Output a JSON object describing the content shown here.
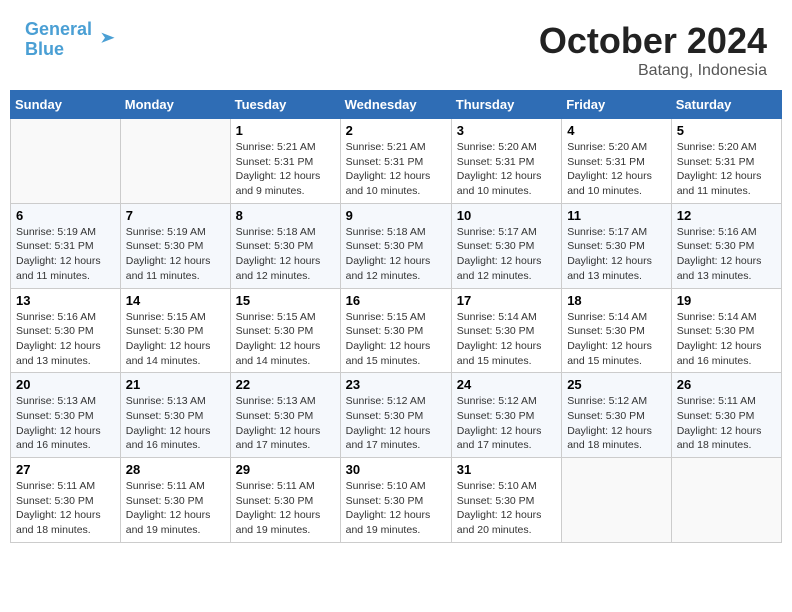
{
  "header": {
    "logo_line1": "General",
    "logo_line2": "Blue",
    "month": "October 2024",
    "location": "Batang, Indonesia"
  },
  "weekdays": [
    "Sunday",
    "Monday",
    "Tuesday",
    "Wednesday",
    "Thursday",
    "Friday",
    "Saturday"
  ],
  "weeks": [
    [
      {
        "day": "",
        "info": ""
      },
      {
        "day": "",
        "info": ""
      },
      {
        "day": "1",
        "info": "Sunrise: 5:21 AM\nSunset: 5:31 PM\nDaylight: 12 hours and 9 minutes."
      },
      {
        "day": "2",
        "info": "Sunrise: 5:21 AM\nSunset: 5:31 PM\nDaylight: 12 hours and 10 minutes."
      },
      {
        "day": "3",
        "info": "Sunrise: 5:20 AM\nSunset: 5:31 PM\nDaylight: 12 hours and 10 minutes."
      },
      {
        "day": "4",
        "info": "Sunrise: 5:20 AM\nSunset: 5:31 PM\nDaylight: 12 hours and 10 minutes."
      },
      {
        "day": "5",
        "info": "Sunrise: 5:20 AM\nSunset: 5:31 PM\nDaylight: 12 hours and 11 minutes."
      }
    ],
    [
      {
        "day": "6",
        "info": "Sunrise: 5:19 AM\nSunset: 5:31 PM\nDaylight: 12 hours and 11 minutes."
      },
      {
        "day": "7",
        "info": "Sunrise: 5:19 AM\nSunset: 5:30 PM\nDaylight: 12 hours and 11 minutes."
      },
      {
        "day": "8",
        "info": "Sunrise: 5:18 AM\nSunset: 5:30 PM\nDaylight: 12 hours and 12 minutes."
      },
      {
        "day": "9",
        "info": "Sunrise: 5:18 AM\nSunset: 5:30 PM\nDaylight: 12 hours and 12 minutes."
      },
      {
        "day": "10",
        "info": "Sunrise: 5:17 AM\nSunset: 5:30 PM\nDaylight: 12 hours and 12 minutes."
      },
      {
        "day": "11",
        "info": "Sunrise: 5:17 AM\nSunset: 5:30 PM\nDaylight: 12 hours and 13 minutes."
      },
      {
        "day": "12",
        "info": "Sunrise: 5:16 AM\nSunset: 5:30 PM\nDaylight: 12 hours and 13 minutes."
      }
    ],
    [
      {
        "day": "13",
        "info": "Sunrise: 5:16 AM\nSunset: 5:30 PM\nDaylight: 12 hours and 13 minutes."
      },
      {
        "day": "14",
        "info": "Sunrise: 5:15 AM\nSunset: 5:30 PM\nDaylight: 12 hours and 14 minutes."
      },
      {
        "day": "15",
        "info": "Sunrise: 5:15 AM\nSunset: 5:30 PM\nDaylight: 12 hours and 14 minutes."
      },
      {
        "day": "16",
        "info": "Sunrise: 5:15 AM\nSunset: 5:30 PM\nDaylight: 12 hours and 15 minutes."
      },
      {
        "day": "17",
        "info": "Sunrise: 5:14 AM\nSunset: 5:30 PM\nDaylight: 12 hours and 15 minutes."
      },
      {
        "day": "18",
        "info": "Sunrise: 5:14 AM\nSunset: 5:30 PM\nDaylight: 12 hours and 15 minutes."
      },
      {
        "day": "19",
        "info": "Sunrise: 5:14 AM\nSunset: 5:30 PM\nDaylight: 12 hours and 16 minutes."
      }
    ],
    [
      {
        "day": "20",
        "info": "Sunrise: 5:13 AM\nSunset: 5:30 PM\nDaylight: 12 hours and 16 minutes."
      },
      {
        "day": "21",
        "info": "Sunrise: 5:13 AM\nSunset: 5:30 PM\nDaylight: 12 hours and 16 minutes."
      },
      {
        "day": "22",
        "info": "Sunrise: 5:13 AM\nSunset: 5:30 PM\nDaylight: 12 hours and 17 minutes."
      },
      {
        "day": "23",
        "info": "Sunrise: 5:12 AM\nSunset: 5:30 PM\nDaylight: 12 hours and 17 minutes."
      },
      {
        "day": "24",
        "info": "Sunrise: 5:12 AM\nSunset: 5:30 PM\nDaylight: 12 hours and 17 minutes."
      },
      {
        "day": "25",
        "info": "Sunrise: 5:12 AM\nSunset: 5:30 PM\nDaylight: 12 hours and 18 minutes."
      },
      {
        "day": "26",
        "info": "Sunrise: 5:11 AM\nSunset: 5:30 PM\nDaylight: 12 hours and 18 minutes."
      }
    ],
    [
      {
        "day": "27",
        "info": "Sunrise: 5:11 AM\nSunset: 5:30 PM\nDaylight: 12 hours and 18 minutes."
      },
      {
        "day": "28",
        "info": "Sunrise: 5:11 AM\nSunset: 5:30 PM\nDaylight: 12 hours and 19 minutes."
      },
      {
        "day": "29",
        "info": "Sunrise: 5:11 AM\nSunset: 5:30 PM\nDaylight: 12 hours and 19 minutes."
      },
      {
        "day": "30",
        "info": "Sunrise: 5:10 AM\nSunset: 5:30 PM\nDaylight: 12 hours and 19 minutes."
      },
      {
        "day": "31",
        "info": "Sunrise: 5:10 AM\nSunset: 5:30 PM\nDaylight: 12 hours and 20 minutes."
      },
      {
        "day": "",
        "info": ""
      },
      {
        "day": "",
        "info": ""
      }
    ]
  ]
}
